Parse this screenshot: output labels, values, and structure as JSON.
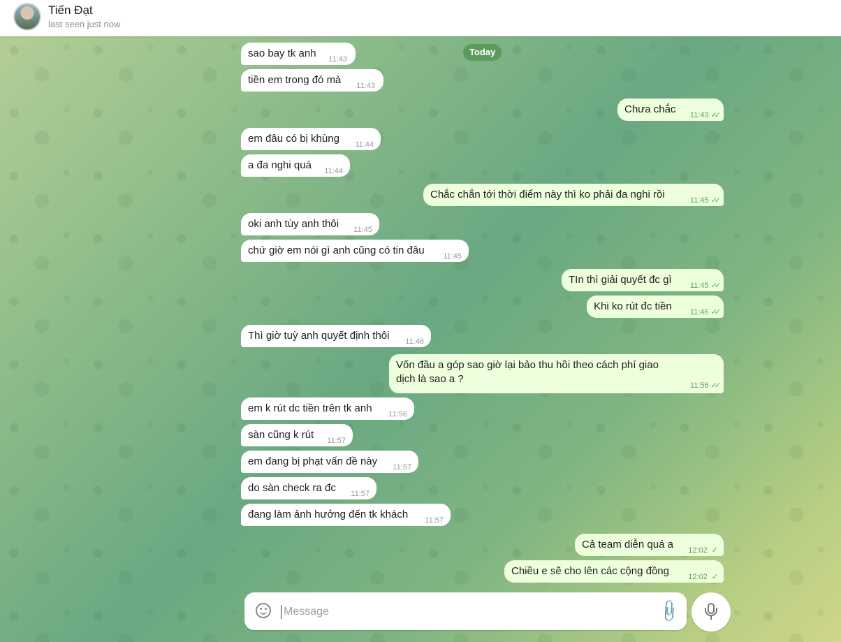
{
  "header": {
    "name": "Tiến Đạt",
    "status": "last seen just now"
  },
  "date_label": "Today",
  "messages": [
    {
      "text": "sao bay tk anh",
      "time": "11:43",
      "dir": "in"
    },
    {
      "text": "tiền em trong đó mà",
      "time": "11:43",
      "dir": "in"
    },
    {
      "text": "Chưa chắc",
      "time": "11:43",
      "dir": "out"
    },
    {
      "text": "em đâu có bị khùng",
      "time": "11:44",
      "dir": "in"
    },
    {
      "text": "a đa nghi quá",
      "time": "11:44",
      "dir": "in"
    },
    {
      "text": "Chắc chắn tới thời điểm này thì ko phải đa nghi rồi",
      "time": "11:45",
      "dir": "out"
    },
    {
      "text": "oki anh tùy anh thôi",
      "time": "11:45",
      "dir": "in"
    },
    {
      "text": "chứ giờ em nói gì anh cũng có tin đâu",
      "time": "11:45",
      "dir": "in"
    },
    {
      "text": "TIn thì giải quyết đc gì",
      "time": "11:45",
      "dir": "out"
    },
    {
      "text": "Khi ko rút đc tiền",
      "time": "11:46",
      "dir": "out"
    },
    {
      "text": "Thì giờ tuỳ anh quyết định thôi",
      "time": "11:46",
      "dir": "in"
    },
    {
      "text": "Vốn đầu a góp sao giờ lại bảo thu hồi theo cách phí giao dịch là sao a ?",
      "time": "11:56",
      "dir": "out"
    },
    {
      "text": "em k rút dc tiền trên tk anh",
      "time": "11:56",
      "dir": "in"
    },
    {
      "text": "sàn cũng k rút",
      "time": "11:57",
      "dir": "in"
    },
    {
      "text": "em đang bị phạt vấn đề này",
      "time": "11:57",
      "dir": "in"
    },
    {
      "text": "do sàn check ra đc",
      "time": "11:57",
      "dir": "in"
    },
    {
      "text": "đang làm ảnh hưởng đến tk khách",
      "time": "11:57",
      "dir": "in"
    },
    {
      "text": "Cả team diễn quá a",
      "time": "12:02",
      "dir": "out"
    },
    {
      "text": "Chiều e sẽ cho lên các cộng đồng",
      "time": "12:02",
      "dir": "out"
    }
  ],
  "composer": {
    "placeholder": "Message"
  },
  "icons": {
    "emoji": "smile-icon",
    "attach": "paperclip-icon",
    "voice": "microphone-icon",
    "read": "double-check-icon",
    "sent": "single-check-icon"
  },
  "colors": {
    "incoming_bubble": "#ffffff",
    "outgoing_bubble": "#eeffde",
    "date_pill": "#5d9b5d",
    "outgoing_time": "#5aa65a"
  }
}
